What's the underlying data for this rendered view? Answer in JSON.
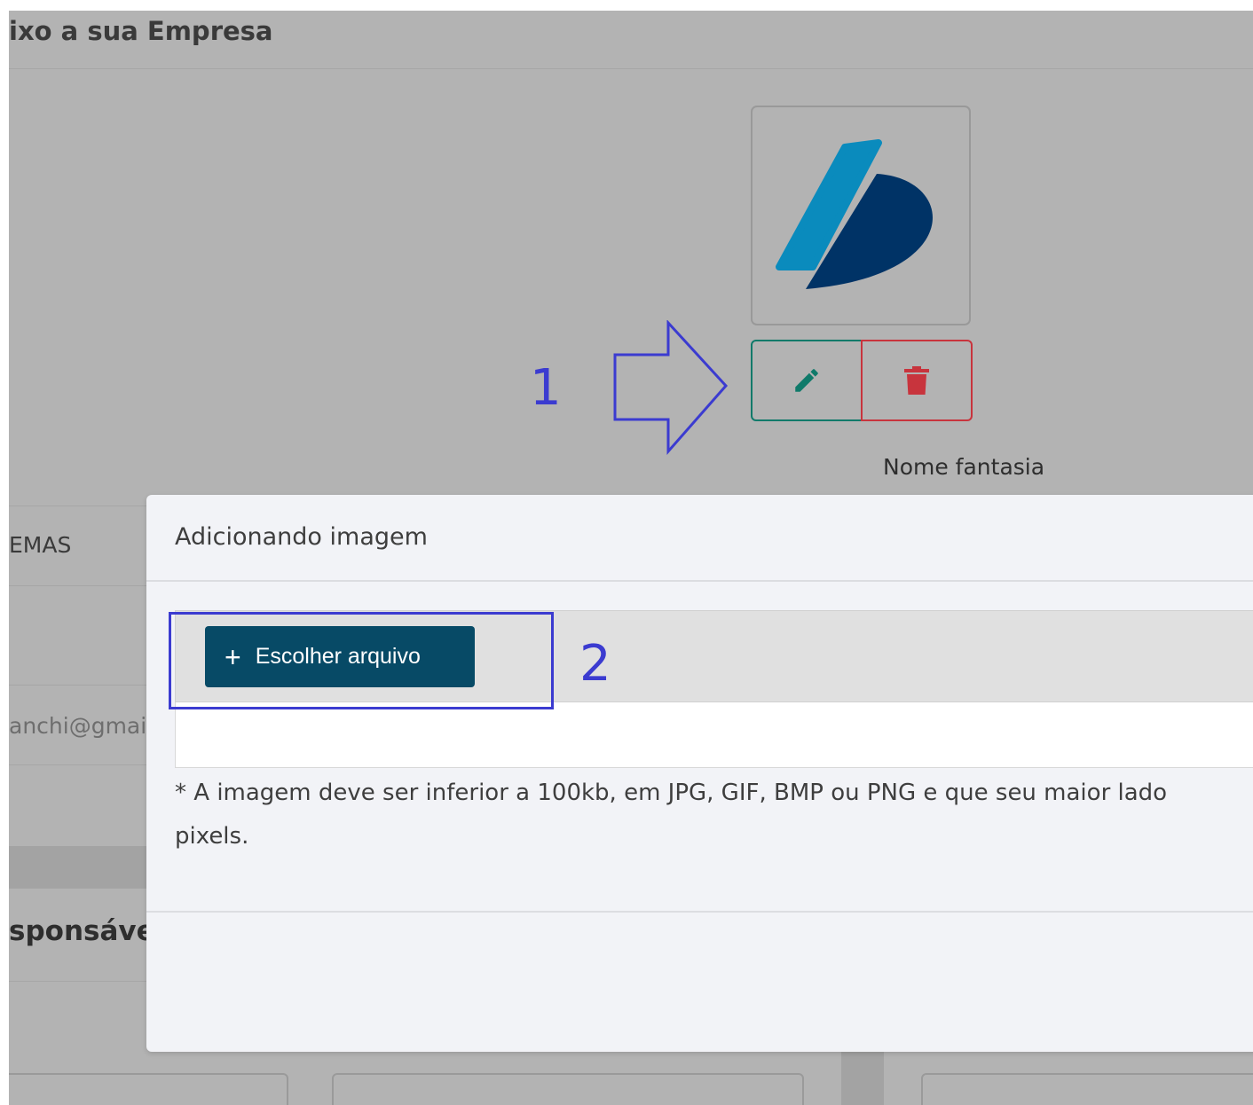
{
  "page": {
    "title": "ixo a sua Empresa",
    "nome_fantasia_label": "Nome fantasia",
    "field_company_value": "EMAS",
    "field_email_value": "anchi@gmail",
    "section_responsavel": "sponsável"
  },
  "logo_actions": {
    "edit_icon": "pencil-icon",
    "delete_icon": "trash-icon",
    "edit_color": "#0f7a6a",
    "delete_color": "#c8343d"
  },
  "annotations": {
    "step1": "1",
    "step2": "2",
    "color": "#3b3bd0"
  },
  "modal": {
    "title": "Adicionando imagem",
    "choose_button_icon": "+",
    "choose_button_label": "Escolher arquivo",
    "note": "* A imagem deve ser inferior a 100kb, em JPG, GIF, BMP ou PNG e que seu maior lado",
    "note_cont": "pixels."
  },
  "colors": {
    "primary": "#074a66",
    "logo_light": "#0a8bbd",
    "logo_dark": "#003366"
  }
}
